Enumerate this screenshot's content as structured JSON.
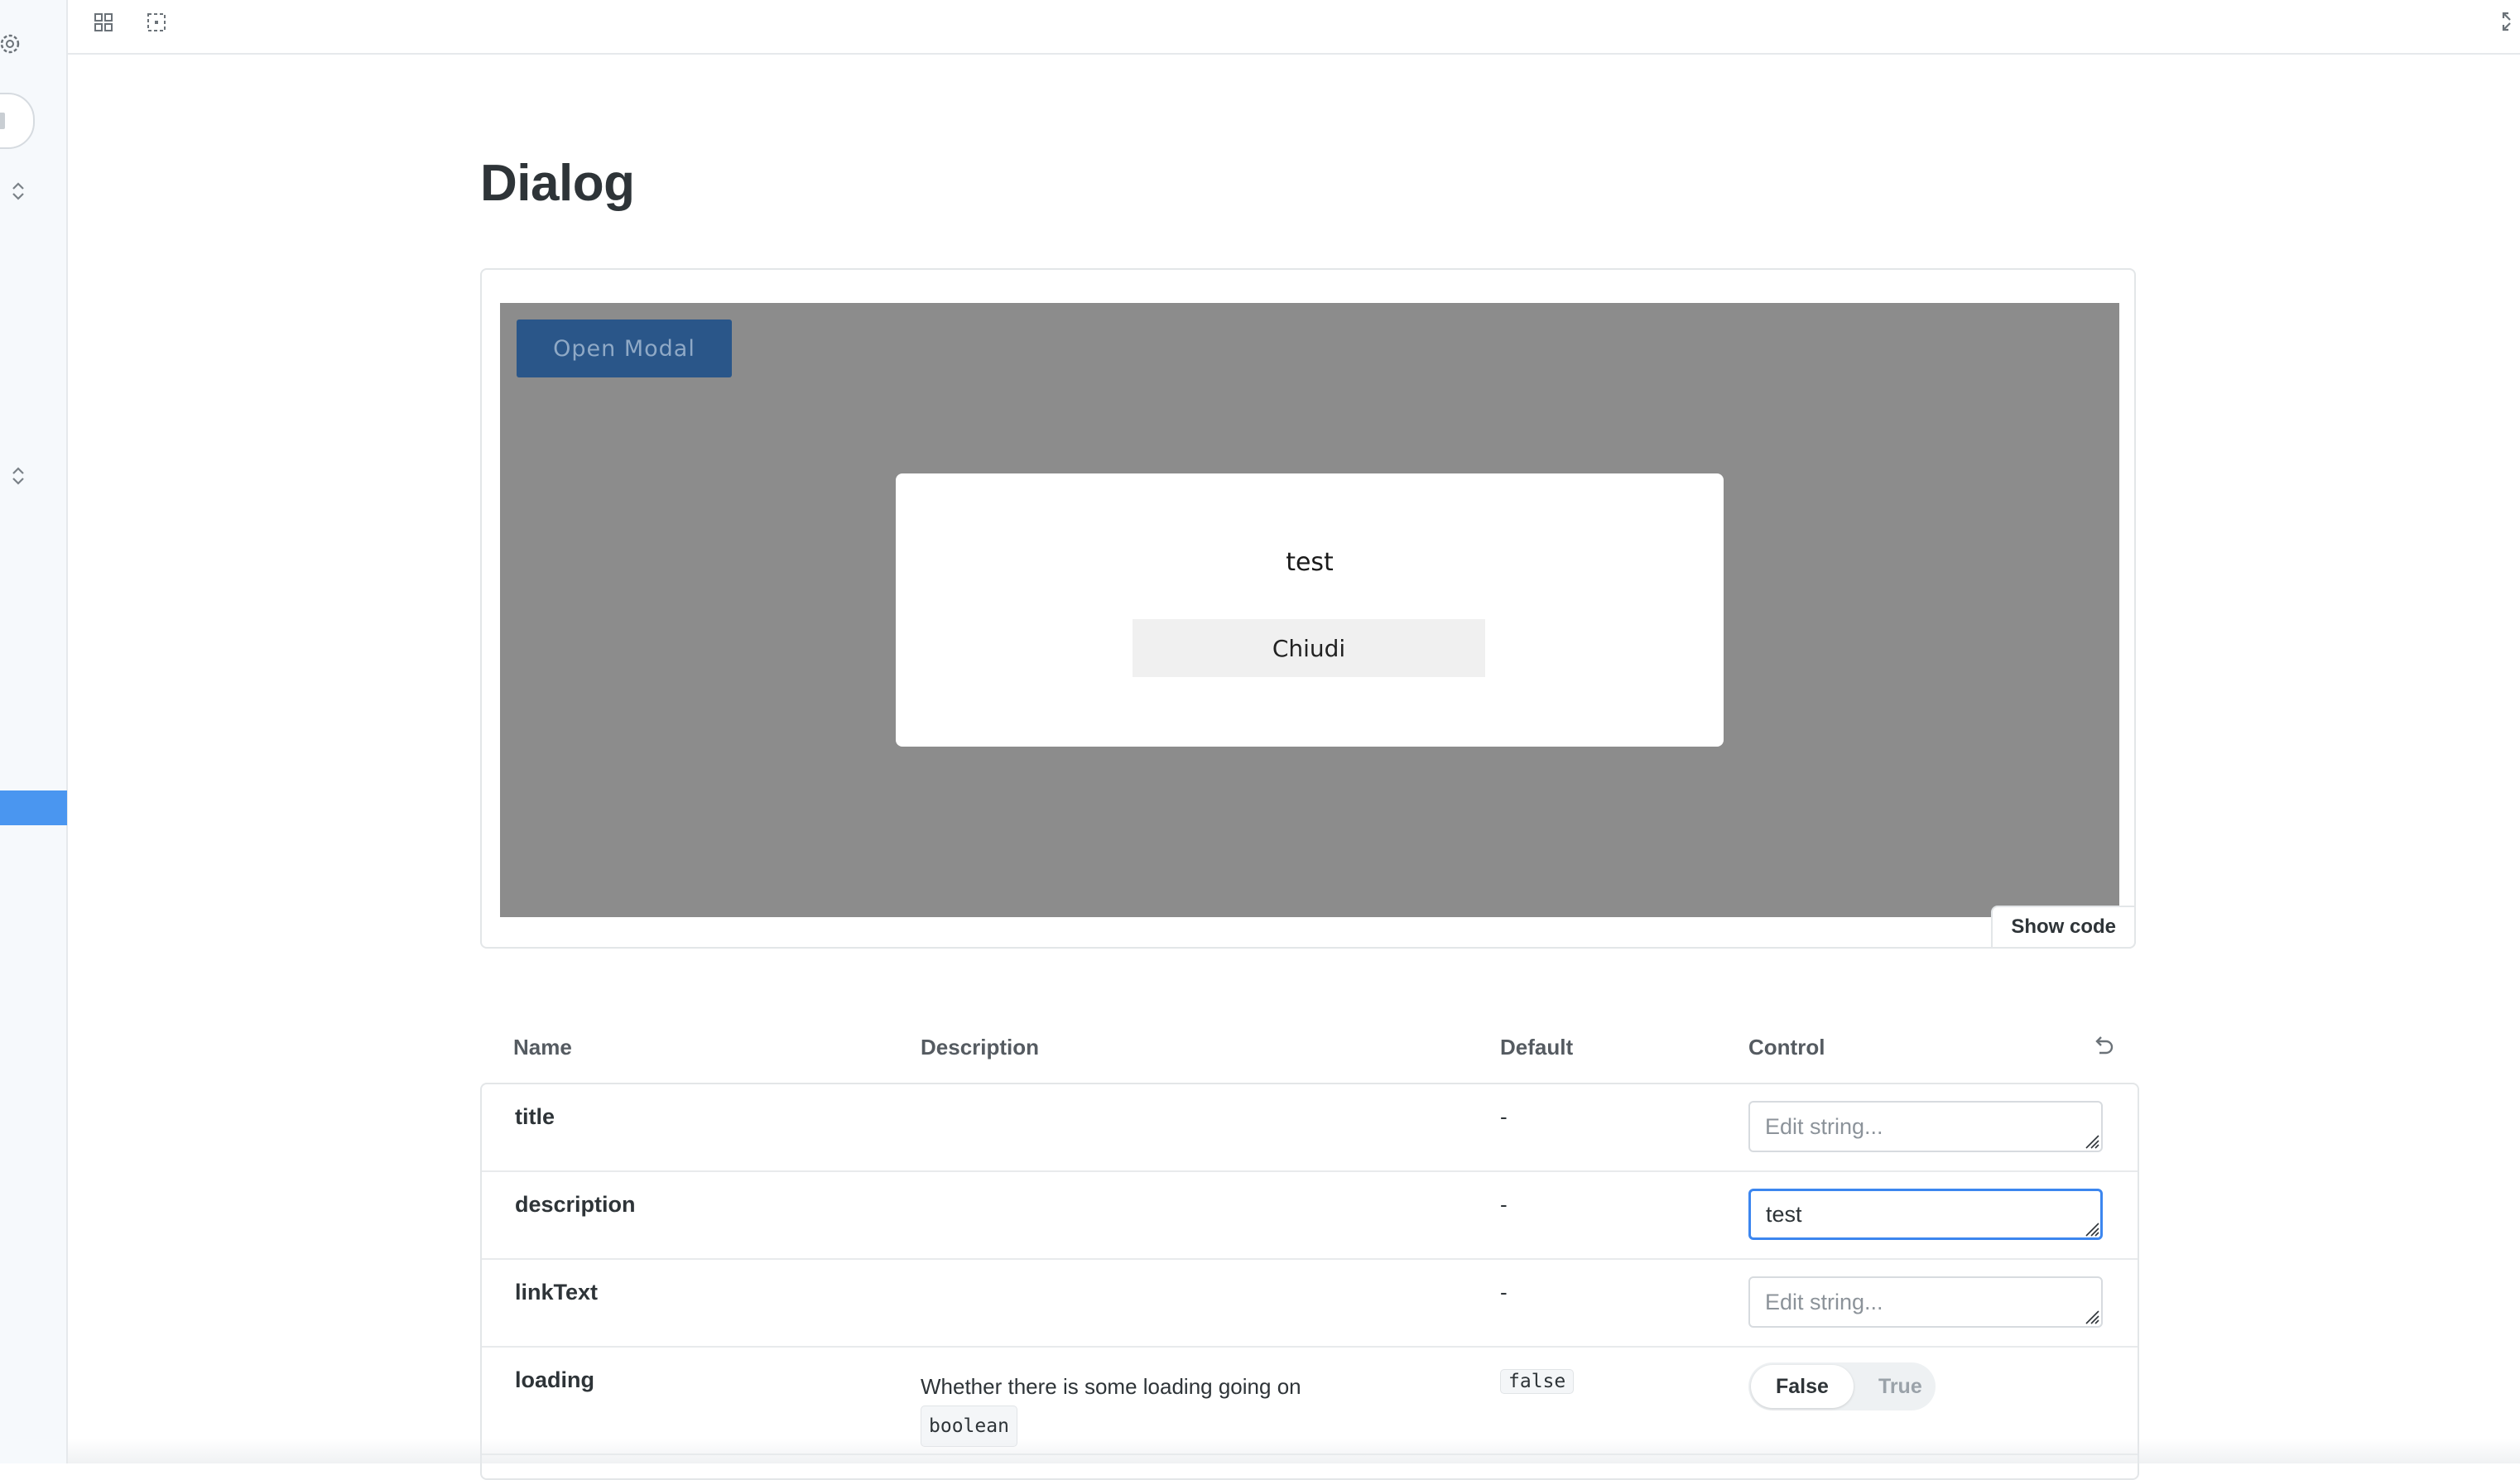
{
  "page": {
    "title": "Dialog"
  },
  "preview": {
    "open_modal_label": "Open Modal",
    "modal_text": "test",
    "modal_close_label": "Chiudi",
    "show_code_label": "Show code"
  },
  "args_table": {
    "headers": {
      "name": "Name",
      "description": "Description",
      "default": "Default",
      "control": "Control"
    },
    "rows": [
      {
        "name": "title",
        "description": "",
        "default": "-",
        "control": {
          "type": "text",
          "value": "",
          "placeholder": "Edit string..."
        }
      },
      {
        "name": "description",
        "description": "",
        "default": "-",
        "control": {
          "type": "text",
          "value": "test",
          "placeholder": "Edit string..."
        }
      },
      {
        "name": "linkText",
        "description": "",
        "default": "-",
        "control": {
          "type": "text",
          "value": "",
          "placeholder": "Edit string..."
        }
      },
      {
        "name": "loading",
        "description": "Whether there is some loading going on",
        "type_chip": "boolean",
        "default_chip": "false",
        "control": {
          "type": "boolean",
          "false_label": "False",
          "true_label": "True",
          "selected": "False"
        }
      }
    ]
  },
  "icons": {
    "sidebar": [
      "gear-icon",
      "chevron-updown-icon"
    ],
    "toolbar": [
      "grid-icon",
      "outline-icon",
      "expand-icon"
    ],
    "table": "undo-icon"
  },
  "colors": {
    "accent": "#4a96f0",
    "focus": "#3c86ef",
    "modal_button": "#2a5689",
    "canvas_backdrop": "#8c8c8c"
  }
}
